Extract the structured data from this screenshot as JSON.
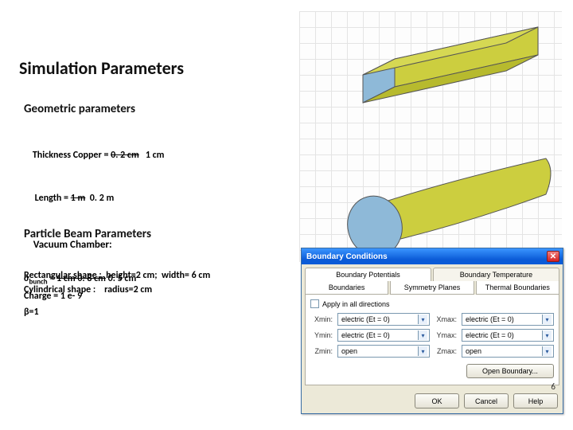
{
  "title": "Simulation Parameters",
  "section1": {
    "heading": "Geometric parameters",
    "thickness_label": "Thickness Copper = ",
    "thickness_struck": "0. 2 cm",
    "thickness_new": "   1 cm",
    "length_label": " Length = ",
    "length_struck": "1 m",
    "length_new": "  0. 2 m",
    "chamber_label": "Vacuum Chamber:",
    "rect_line": "Rectangular shape :  height=2 cm;  width= 6 cm",
    "cyl_line": "Cylindrical shape :    radius=2 cm"
  },
  "section2": {
    "heading": "Particle Beam Parameters",
    "sigma_sym": "σ",
    "sigma_sub": "bunch",
    "sigma_rest": " = ",
    "sigma_struck": "1 cm 0. 8 cm",
    "sigma_new": "  0. 5 cm",
    "charge": "Charge = 1 e- 9",
    "beta": "β=1"
  },
  "dialog": {
    "title": "Boundary Conditions",
    "tab_pot": "Boundary Potentials",
    "tab_temp": "Boundary Temperature",
    "sub_bound": "Boundaries",
    "sub_sym": "Symmetry Planes",
    "sub_therm": "Thermal Boundaries",
    "apply_all": "Apply in all directions",
    "xmin_l": "Xmin:",
    "xmin_v": "electric (Et = 0)",
    "xmax_l": "Xmax:",
    "xmax_v": "electric (Et = 0)",
    "ymin_l": "Ymin:",
    "ymin_v": "electric (Et = 0)",
    "ymax_l": "Ymax:",
    "ymax_v": "electric (Et = 0)",
    "zmin_l": "Zmin:",
    "zmin_v": "open",
    "zmax_l": "Zmax:",
    "zmax_v": "open",
    "open_boundary": "Open Boundary...",
    "ok": "OK",
    "cancel": "Cancel",
    "help": "Help"
  },
  "page_number": "6"
}
